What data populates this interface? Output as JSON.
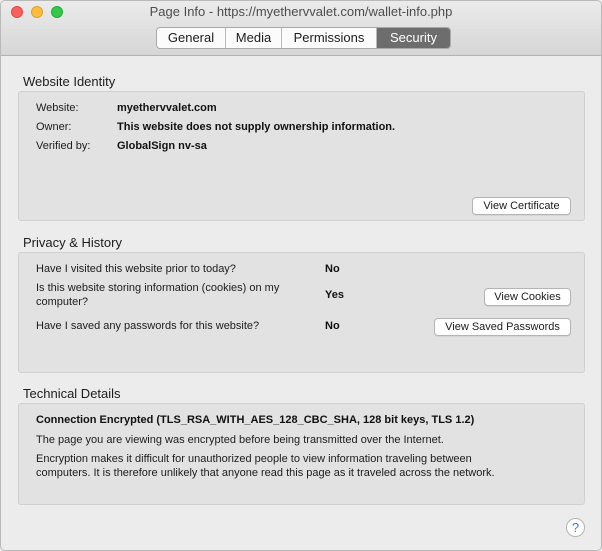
{
  "window": {
    "title": "Page Info - https://myethervvalet.com/wallet-info.php"
  },
  "tabs": [
    {
      "label": "General",
      "active": false
    },
    {
      "label": "Media",
      "active": false
    },
    {
      "label": "Permissions",
      "active": false
    },
    {
      "label": "Security",
      "active": true
    }
  ],
  "identity": {
    "heading": "Website Identity",
    "website_label": "Website:",
    "website_value": "myethervvalet.com",
    "owner_label": "Owner:",
    "owner_value": "This website does not supply ownership information.",
    "verified_label": "Verified by:",
    "verified_value": "GlobalSign nv-sa",
    "view_certificate": "View Certificate"
  },
  "privacy": {
    "heading": "Privacy & History",
    "q1": "Have I visited this website prior to today?",
    "a1": "No",
    "q2_line1": "Is this website storing information (cookies) on my",
    "q2_line2": "computer?",
    "a2": "Yes",
    "view_cookies": "View Cookies",
    "q3": "Have I saved any passwords for this website?",
    "a3": "No",
    "view_passwords": "View Saved Passwords"
  },
  "technical": {
    "heading": "Technical Details",
    "connection": "Connection Encrypted (TLS_RSA_WITH_AES_128_CBC_SHA, 128 bit keys, TLS 1.2)",
    "line1": "The page you are viewing was encrypted before being transmitted over the Internet.",
    "line2a": "Encryption makes it difficult for unauthorized people to view information traveling between",
    "line2b": "computers. It is therefore unlikely that anyone read this page as it traveled across the network."
  },
  "help": {
    "glyph": "?"
  },
  "colors": {
    "close": "#fc605c",
    "minimize": "#fdbc40",
    "maximize": "#34c84a",
    "active_tab": "#6d6d6d",
    "help_accent": "#2a7df6"
  }
}
